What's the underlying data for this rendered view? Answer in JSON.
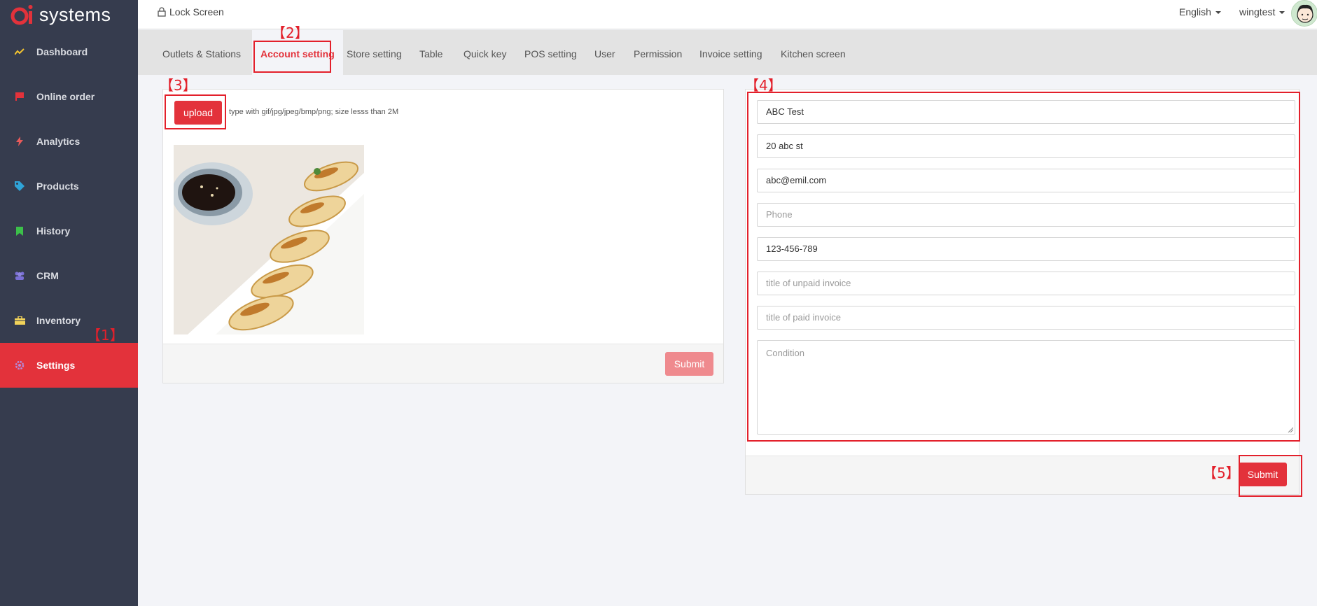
{
  "app": {
    "brand": "systems"
  },
  "topbar": {
    "lock_label": "Lock Screen",
    "language": "English",
    "username": "wingtest"
  },
  "sidebar": {
    "items": [
      {
        "label": "Dashboard",
        "icon": "line-chart-icon",
        "color": "#f4c430"
      },
      {
        "label": "Online order",
        "icon": "flag-icon",
        "color": "#e3323b"
      },
      {
        "label": "Analytics",
        "icon": "bolt-icon",
        "color": "#e85a5a"
      },
      {
        "label": "Products",
        "icon": "tags-icon",
        "color": "#2fa4d8"
      },
      {
        "label": "History",
        "icon": "bookmark-icon",
        "color": "#3cc04a"
      },
      {
        "label": "CRM",
        "icon": "users-icon",
        "color": "#7a6fd6"
      },
      {
        "label": "Inventory",
        "icon": "briefcase-icon",
        "color": "#f2d35a"
      },
      {
        "label": "Settings",
        "icon": "gear-icon",
        "color": "#b58ad8",
        "active": true
      }
    ]
  },
  "tabs": [
    "Outlets & Stations",
    "Account setting",
    "Store setting",
    "Table",
    "Quick key",
    "POS setting",
    "User",
    "Permission",
    "Invoice setting",
    "Kitchen screen"
  ],
  "active_tab": "Account setting",
  "annotations": [
    "【1】",
    "【2】",
    "【3】",
    "【4】",
    "【5】"
  ],
  "logo_panel": {
    "upload_label": "upload",
    "upload_hint": "type with gif/jpg/jpeg/bmp/png; size lesss than 2M",
    "image_alt": "dumplings",
    "submit_label": "Submit"
  },
  "account_form": {
    "company_name": {
      "value": "ABC Test",
      "placeholder": ""
    },
    "address": {
      "value": "20 abc st",
      "placeholder": ""
    },
    "email": {
      "value": "abc@emil.com",
      "placeholder": ""
    },
    "phone": {
      "value": "",
      "placeholder": "Phone"
    },
    "fax": {
      "value": "123-456-789",
      "placeholder": ""
    },
    "unpaid_title": {
      "value": "",
      "placeholder": "title of unpaid invoice"
    },
    "paid_title": {
      "value": "",
      "placeholder": "title of paid invoice"
    },
    "condition": {
      "value": "",
      "placeholder": "Condition"
    },
    "submit_label": "Submit"
  },
  "colors": {
    "accent": "#e3323b",
    "sidebar_bg": "#363c4e",
    "annotation": "#e3202b"
  }
}
